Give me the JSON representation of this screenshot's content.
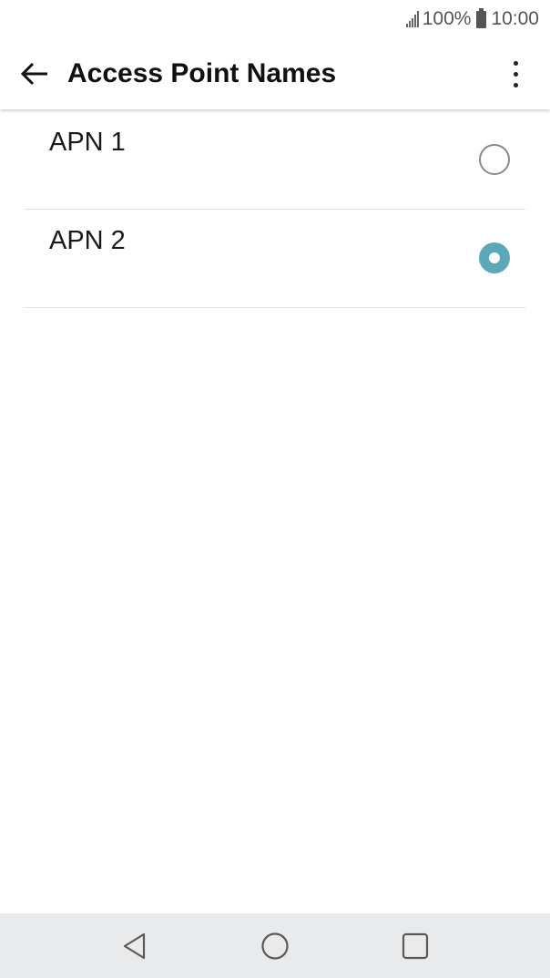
{
  "status_bar": {
    "battery_percent": "100%",
    "time": "10:00",
    "signal_icon": "signal-icon",
    "battery_icon": "battery-icon"
  },
  "app_bar": {
    "title": "Access Point Names",
    "back_icon": "arrow-left-icon",
    "overflow_icon": "more-vert-icon"
  },
  "apn_list": [
    {
      "name": "APN 1",
      "selected": false
    },
    {
      "name": "APN 2",
      "selected": true
    }
  ],
  "nav_bar": {
    "back_icon": "triangle-back-icon",
    "home_icon": "circle-home-icon",
    "recents_icon": "square-recents-icon"
  },
  "colors": {
    "accent": "#5aa8b8",
    "nav_background": "#e9eaec"
  }
}
